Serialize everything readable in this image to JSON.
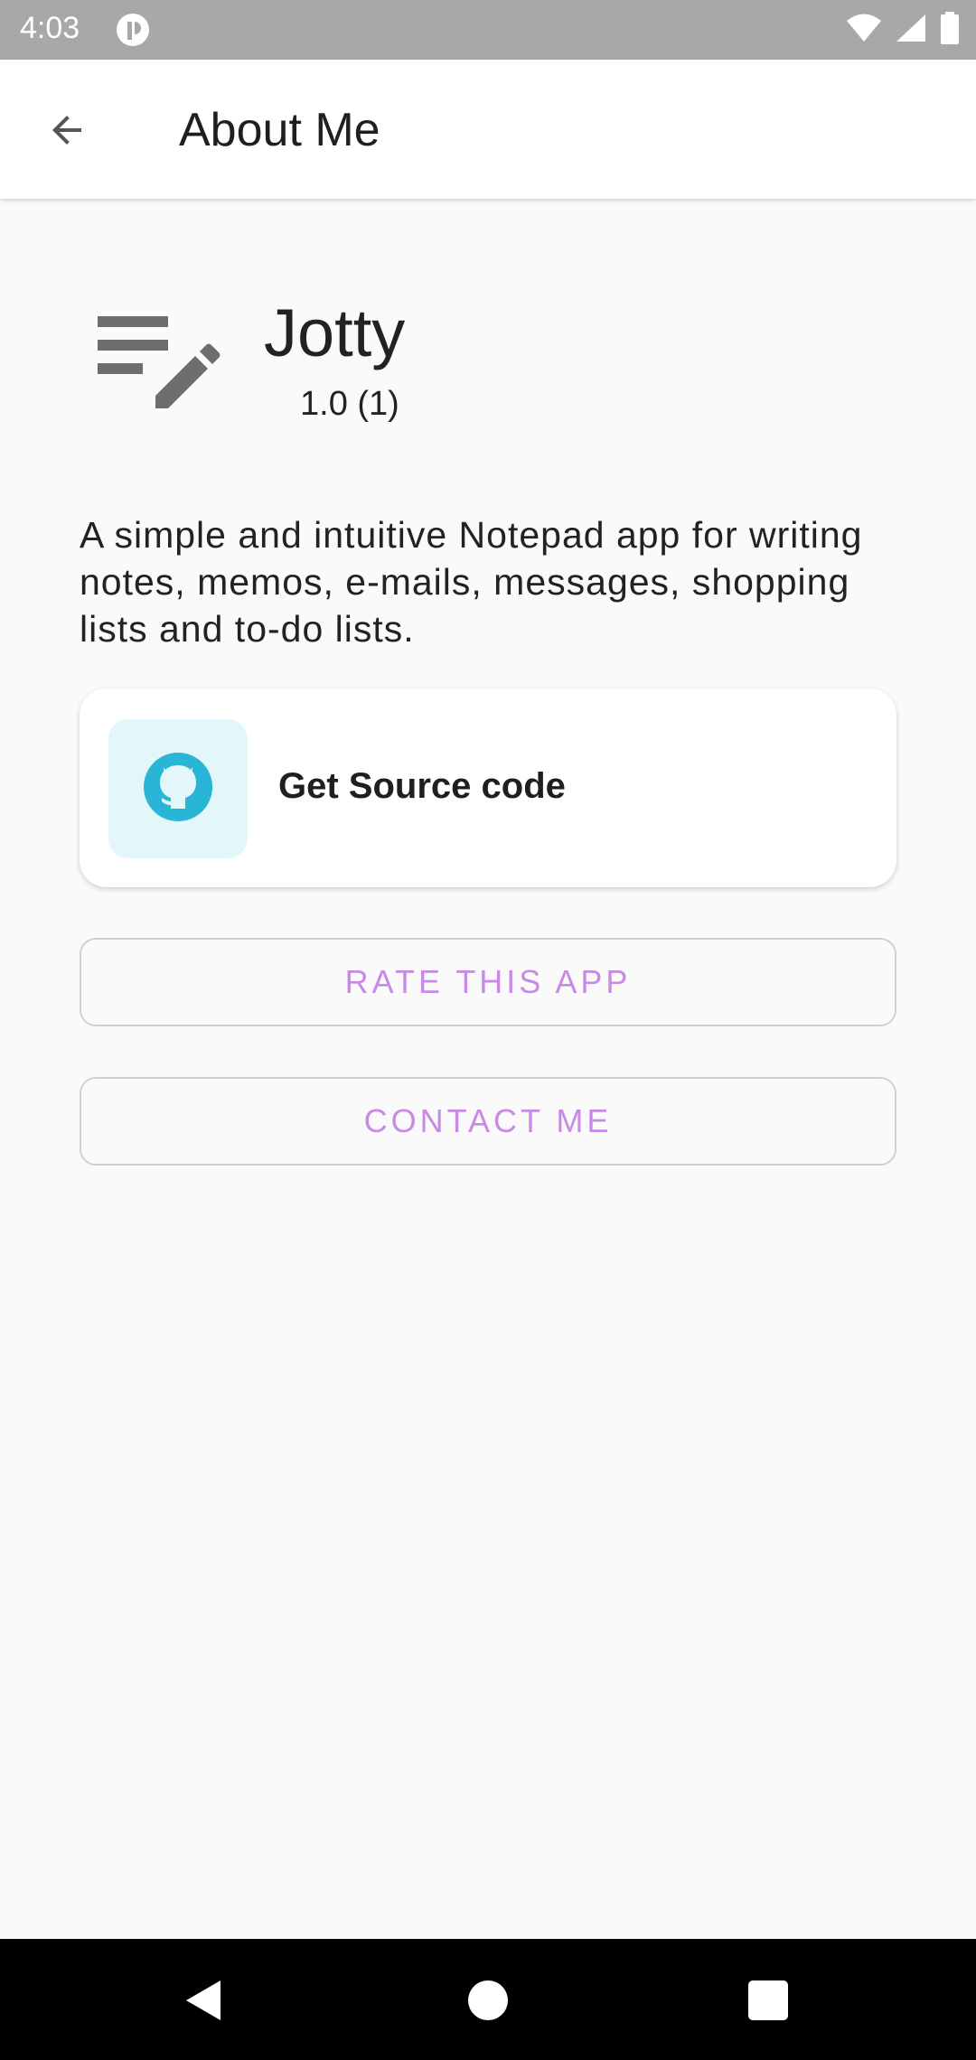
{
  "status_bar": {
    "time": "4:03",
    "icons": [
      "app-notification-icon",
      "wifi-icon",
      "signal-icon",
      "battery-icon"
    ]
  },
  "app_bar": {
    "back_icon": "arrow-back-icon",
    "title": "About Me"
  },
  "app_info": {
    "icon": "notes-edit-icon",
    "name": "Jotty",
    "version": "1.0 (1)",
    "description": "A simple and intuitive Notepad app for writing notes, memos, e-mails, messages, shopping lists and to-do lists."
  },
  "source_card": {
    "icon": "github-icon",
    "label": "Get Source code"
  },
  "buttons": {
    "rate_label": "RATE THIS APP",
    "contact_label": "CONTACT ME"
  },
  "nav_bar": {
    "icons": [
      "nav-back-icon",
      "nav-home-icon",
      "nav-recents-icon"
    ]
  },
  "colors": {
    "status_bar": "#a8a8a8",
    "accent_text": "#c88ae6",
    "github_icon": "#29b6d6",
    "github_icon_bg": "#e3f6fa",
    "background": "#fafafa"
  }
}
